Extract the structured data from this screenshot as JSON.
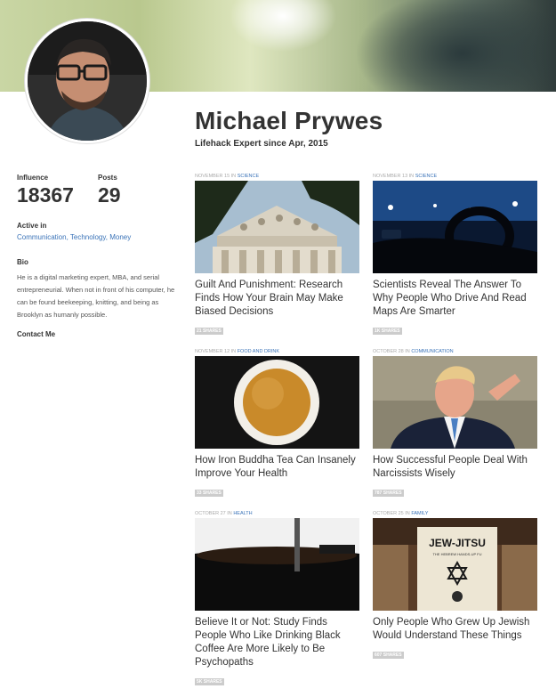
{
  "profile": {
    "name": "Michael Prywes",
    "since": "Lifehack Expert since Apr, 2015",
    "influence_label": "Influence",
    "influence_value": "18367",
    "posts_label": "Posts",
    "posts_value": "29",
    "active_label": "Active in",
    "active_links": [
      "Communication",
      "Technology",
      "Money"
    ],
    "bio_label": "Bio",
    "bio_text": "He is a digital marketing expert, MBA, and serial entrepreneurial. When not in front of his computer, he can be found beekeeping, knitting, and being as Brooklyn as humanly possible.",
    "contact_label": "Contact Me"
  },
  "articles": [
    {
      "date": "NOVEMBER 15",
      "in": "IN",
      "category": "SCIENCE",
      "title": "Guilt And Punishment: Research Finds How Your Brain May Make Biased Decisions",
      "shares": "21 SHARES",
      "thumb": "courthouse-image"
    },
    {
      "date": "NOVEMBER 13",
      "in": "IN",
      "category": "SCIENCE",
      "title": "Scientists Reveal The Answer To Why People Who Drive And Read Maps Are Smarter",
      "shares": "1K SHARES",
      "thumb": "car-interior-image"
    },
    {
      "date": "NOVEMBER 12",
      "in": "IN",
      "category": "FOOD AND DRINK",
      "title": "How Iron Buddha Tea Can Insanely Improve Your Health",
      "shares": "33 SHARES",
      "thumb": "tea-cup-image"
    },
    {
      "date": "OCTOBER 28",
      "in": "IN",
      "category": "COMMUNICATION",
      "title": "How Successful People Deal With Narcissists Wisely",
      "shares": "787 SHARES",
      "thumb": "man-pointing-image"
    },
    {
      "date": "OCTOBER 27",
      "in": "IN",
      "category": "HEALTH",
      "title": "Believe It or Not: Study Finds People Who Like Drinking Black Coffee Are More Likely to Be Psychopaths",
      "shares": "5K SHARES",
      "thumb": "coffee-press-image"
    },
    {
      "date": "OCTOBER 25",
      "in": "IN",
      "category": "FAMILY",
      "title": "Only People Who Grew Up Jewish Would Understand These Things",
      "shares": "607 SHARES",
      "thumb": "book-image",
      "book_title": "JEW-JITSU",
      "book_subtitle": "THE HEBREW HANDS-UP FU"
    }
  ],
  "colors": {
    "link": "#3a73b8",
    "text": "#333333",
    "shares_bg": "#cccccc"
  }
}
